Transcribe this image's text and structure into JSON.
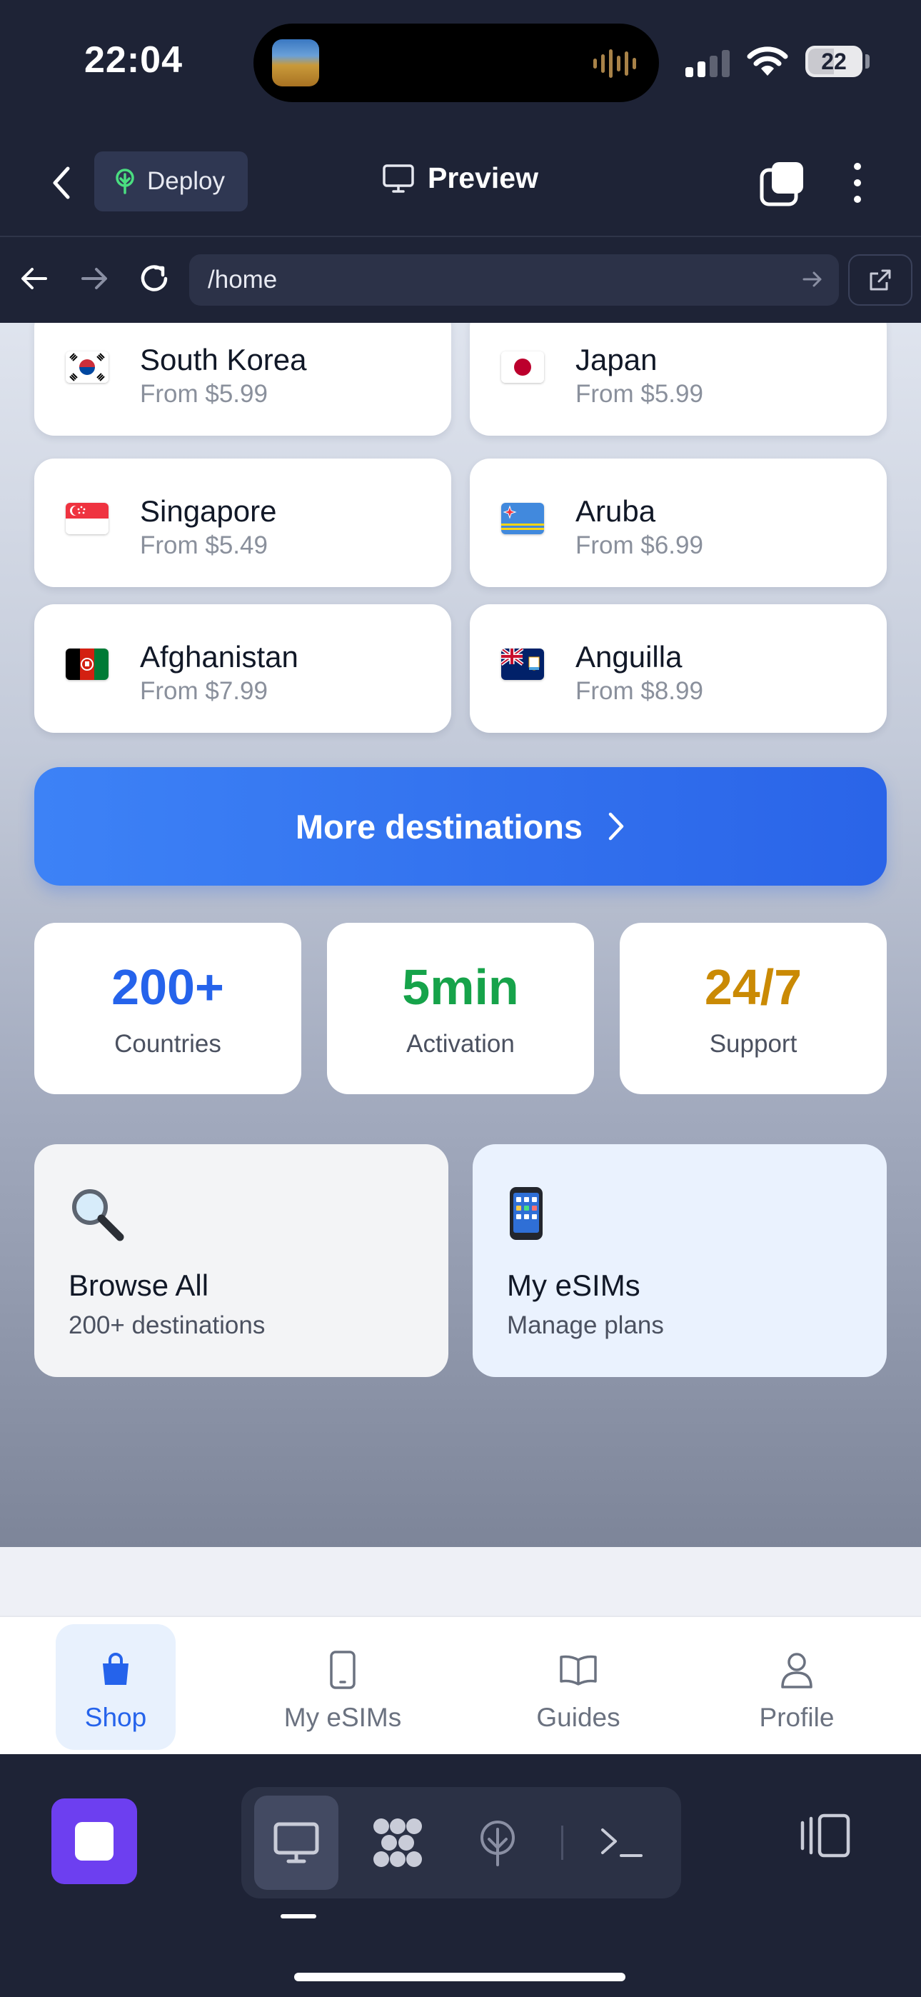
{
  "status_bar": {
    "time": "22:04",
    "battery": "22"
  },
  "header": {
    "deploy_label": "Deploy",
    "preview_label": "Preview"
  },
  "url_bar": {
    "path": "/home"
  },
  "destinations": [
    {
      "name": "South Korea",
      "price": "From $5.99",
      "flag": "south-korea-flag"
    },
    {
      "name": "Japan",
      "price": "From $5.99",
      "flag": "japan-flag"
    },
    {
      "name": "Singapore",
      "price": "From $5.49",
      "flag": "singapore-flag"
    },
    {
      "name": "Aruba",
      "price": "From $6.99",
      "flag": "aruba-flag"
    },
    {
      "name": "Afghanistan",
      "price": "From $7.99",
      "flag": "afghanistan-flag"
    },
    {
      "name": "Anguilla",
      "price": "From $8.99",
      "flag": "anguilla-flag"
    }
  ],
  "more_button": {
    "label": "More destinations"
  },
  "stats": [
    {
      "value": "200+",
      "label": "Countries",
      "color": "#2563eb"
    },
    {
      "value": "5min",
      "label": "Activation",
      "color": "#16a34a"
    },
    {
      "value": "24/7",
      "label": "Support",
      "color": "#ca8a04"
    }
  ],
  "actions": [
    {
      "title": "Browse All",
      "subtitle": "200+ destinations",
      "icon": "magnifier-icon"
    },
    {
      "title": "My eSIMs",
      "subtitle": "Manage plans",
      "icon": "mobile-phone-icon"
    }
  ],
  "tabbar": [
    {
      "label": "Shop",
      "icon": "shopping-bag-icon",
      "active": true
    },
    {
      "label": "My eSIMs",
      "icon": "phone-icon",
      "active": false
    },
    {
      "label": "Guides",
      "icon": "book-icon",
      "active": false
    },
    {
      "label": "Profile",
      "icon": "user-icon",
      "active": false
    }
  ],
  "colors": {
    "accent": "#2563eb",
    "background": "#1e2336",
    "active_tab_bg": "#e8f1fd",
    "app_icon": "#6d3ff0"
  }
}
